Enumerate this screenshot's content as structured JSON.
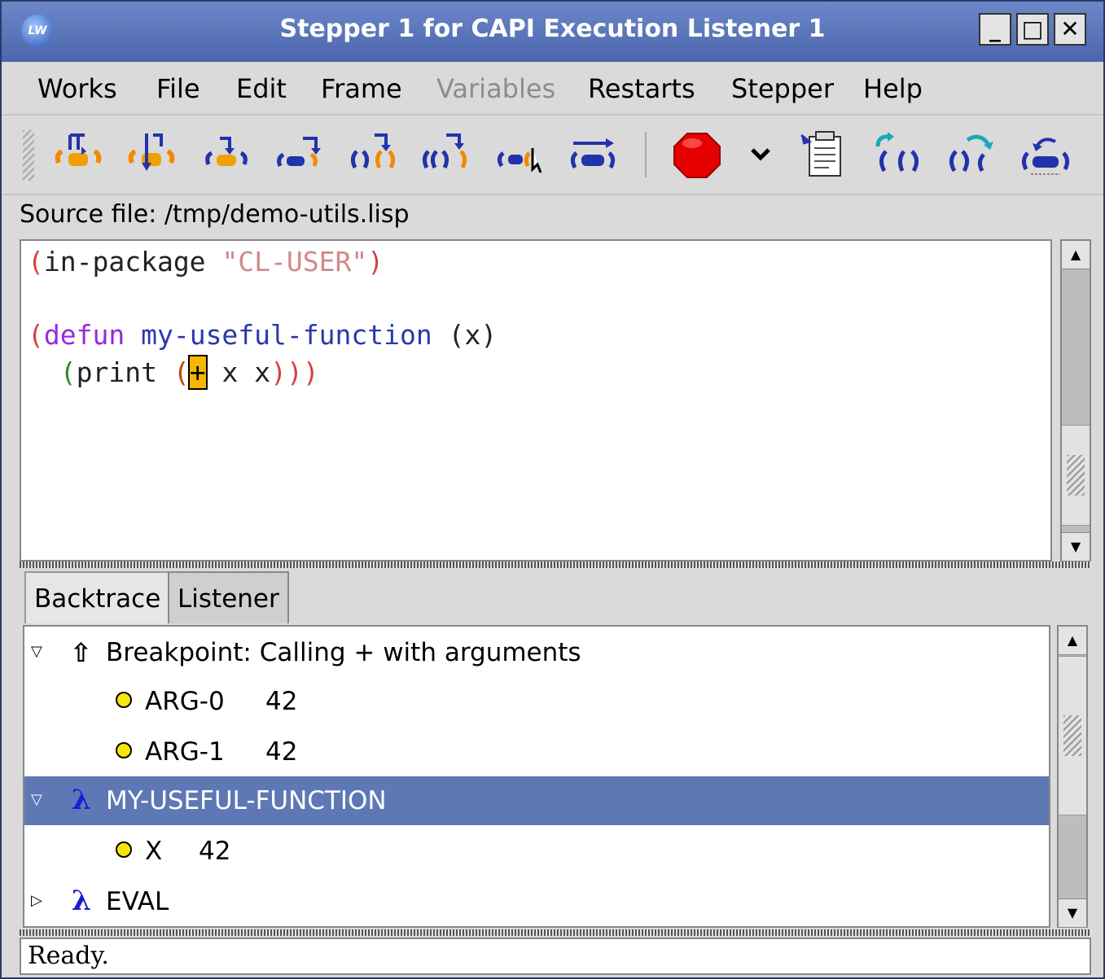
{
  "window": {
    "title": "Stepper 1 for CAPI Execution Listener 1",
    "logo_text": "LW",
    "minimize": "_",
    "maximize": "□",
    "close": "✕"
  },
  "menubar": {
    "works": "Works",
    "file": "File",
    "edit": "Edit",
    "frame": "Frame",
    "variables": "Variables",
    "restarts": "Restarts",
    "stepper": "Stepper",
    "help": "Help"
  },
  "toolbar": {
    "icons": [
      "step-through-call-icon",
      "step-into-icon",
      "step-to-cursor-icon",
      "step-over-icon",
      "step-next-form-icon",
      "step-out-icon",
      "step-to-value-icon",
      "continue-icon",
      "stop-icon",
      "dropdown-icon",
      "source-file-icon",
      "restart-frame-icon",
      "return-from-frame-icon",
      "undo-macroexpand-icon"
    ],
    "stop_color": "#e60000"
  },
  "source": {
    "label": "Source file: /tmp/demo-utils.lisp"
  },
  "code": {
    "l1_open": "(",
    "l1_head": "in-package",
    "l1_str": "\"CL-USER\"",
    "l1_close": ")",
    "l2_open": "(",
    "l2_kw": "defun",
    "l2_name": "my-useful-function",
    "l2_args": "(x)",
    "l3_indent": "  ",
    "l3_open": "(",
    "l3_head": "print",
    "l3_open2": "(",
    "l3_op": "+",
    "l3_rest": " x x",
    "l3_close": ")))"
  },
  "tabs": {
    "backtrace": "Backtrace",
    "listener": "Listener"
  },
  "backtrace": {
    "breakpoint": "Breakpoint: Calling + with arguments",
    "arg0_name": "ARG-0",
    "arg0_value": "42",
    "arg1_name": "ARG-1",
    "arg1_value": "42",
    "frame1": "MY-USEFUL-FUNCTION",
    "x_name": "X",
    "x_value": "42",
    "frame2": "EVAL",
    "expanded_glyph": "▽",
    "collapsed_glyph": "▷",
    "lambda": "λ",
    "up_arrow": "⇧"
  },
  "status": {
    "text": "Ready."
  }
}
